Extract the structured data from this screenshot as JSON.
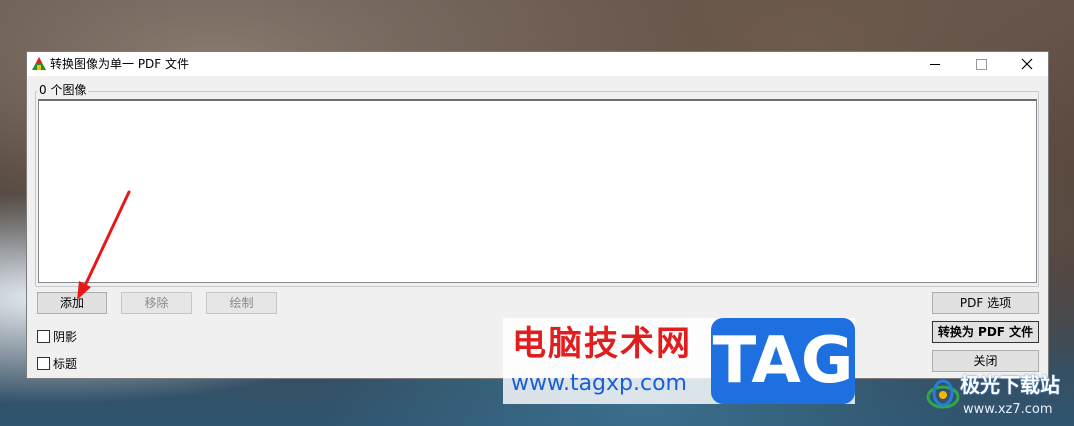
{
  "window": {
    "title": "转换图像为单一 PDF 文件"
  },
  "group": {
    "legend": "0 个图像"
  },
  "buttons": {
    "add": "添加",
    "remove": "移除",
    "draw": "绘制",
    "pdf_options": "PDF 选项",
    "convert": "转换为 PDF 文件",
    "close": "关闭"
  },
  "checkboxes": {
    "shadow": "阴影",
    "title": "标题"
  },
  "watermark": {
    "site_cn": "电脑技术网",
    "site_url": "www.tagxp.com",
    "tag": "TAG",
    "site2_cn": "极光下载站",
    "site2_url": "www.xz7.com"
  },
  "icons": {
    "app": "app-logo-icon",
    "minimize": "minimize-icon",
    "maximize": "maximize-icon",
    "close": "close-icon"
  }
}
